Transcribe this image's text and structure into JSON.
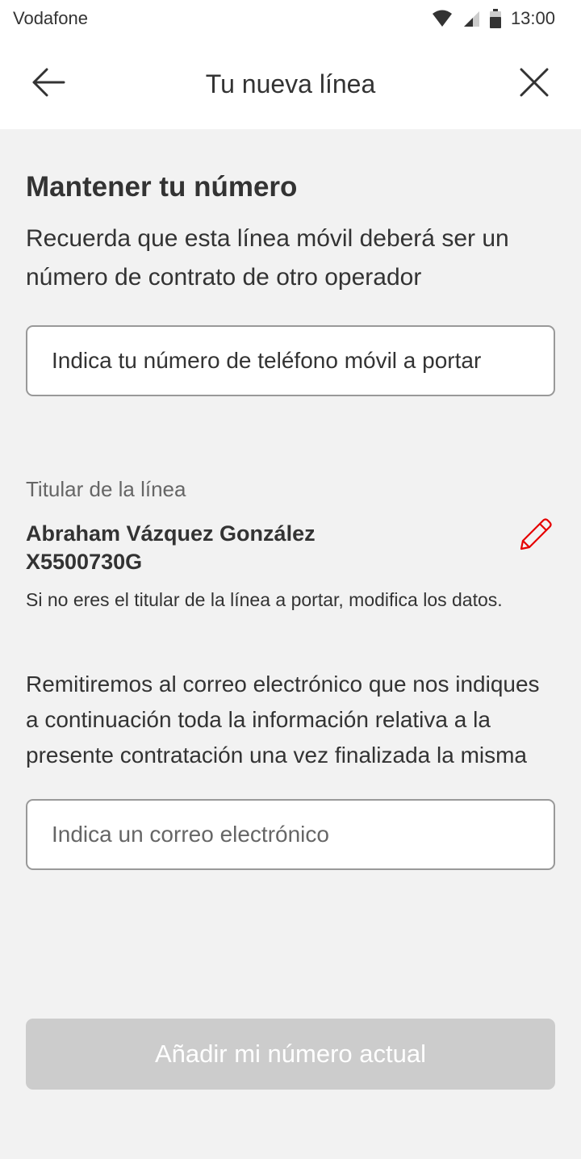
{
  "status_bar": {
    "carrier": "Vodafone",
    "time": "13:00",
    "icons": [
      "wifi-icon",
      "signal-icon",
      "battery-icon"
    ]
  },
  "header": {
    "title": "Tu nueva línea",
    "back_icon": "arrow-left-icon",
    "close_icon": "close-icon"
  },
  "section": {
    "title": "Mantener tu número",
    "description": "Recuerda que esta línea móvil deberá ser un número de contrato de otro operador"
  },
  "phone_input": {
    "placeholder": "Indica tu número de teléfono móvil a portar",
    "value": ""
  },
  "holder": {
    "label": "Titular de la línea",
    "name": "Abraham Vázquez González",
    "id": "X5500730G",
    "note": "Si no eres el titular de la línea a portar, modifica los datos.",
    "edit_icon": "pencil-icon"
  },
  "email": {
    "description": "Remitiremos al correo electrónico que nos indiques a continuación toda la información relativa a la presente contratación una vez finalizada la misma",
    "placeholder": "Indica un correo electrónico",
    "value": ""
  },
  "actions": {
    "primary_label": "Añadir mi número actual",
    "primary_state": "disabled"
  },
  "colors": {
    "accent_red": "#e60000",
    "background": "#f2f2f2",
    "text": "#333333",
    "button_disabled": "#cccccc"
  }
}
